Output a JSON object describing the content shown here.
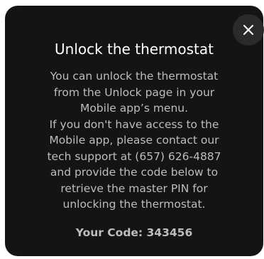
{
  "dialog": {
    "close_icon": "close-icon",
    "title": "Unlock the thermostat",
    "message_lines": [
      "You can unlock the thermostat",
      "from the Unlock page in your",
      "Mobile app’s menu.",
      "If you don't have access to the",
      "Mobile app, please contact our",
      "tech support at (657) 626-4887",
      "and provide the code below to",
      "retrieve the master PIN for",
      "unlocking the thermostat."
    ],
    "code_text": "Your Code: 343456"
  },
  "colors": {
    "dialog_background": "#141414",
    "close_button_background": "#2a2a2a",
    "title_text": "#ffffff",
    "body_text": "#bdbdbd"
  }
}
